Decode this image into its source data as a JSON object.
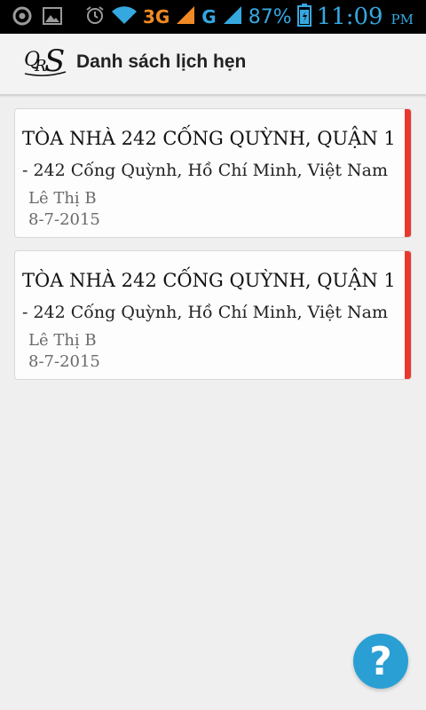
{
  "status_bar": {
    "network_3g": "3G",
    "network_g": "G",
    "battery": "87%",
    "time": "11:09",
    "ampm": "PM"
  },
  "header": {
    "logo_text": "QRS",
    "title": "Danh sách lịch hẹn"
  },
  "appointments": [
    {
      "address_line": "TÒA NHÀ 242 CỐNG QUỲNH, QUẬN 1",
      "address_rest": " - 242 Cống Quỳnh, Hồ Chí Minh, Việt Nam",
      "person": "Lê Thị B",
      "date": "8-7-2015"
    },
    {
      "address_line": "TÒA NHÀ 242 CỐNG QUỲNH, QUẬN 1",
      "address_rest": " - 242 Cống Quỳnh, Hồ Chí Minh, Việt Nam",
      "person": "Lê Thị B",
      "date": "8-7-2015"
    }
  ],
  "help_button": {
    "label": "?"
  },
  "colors": {
    "accent_bar": "#e8392e",
    "status_blue": "#35a8e0",
    "status_orange": "#f08a24",
    "fab": "#2a9fd4"
  }
}
